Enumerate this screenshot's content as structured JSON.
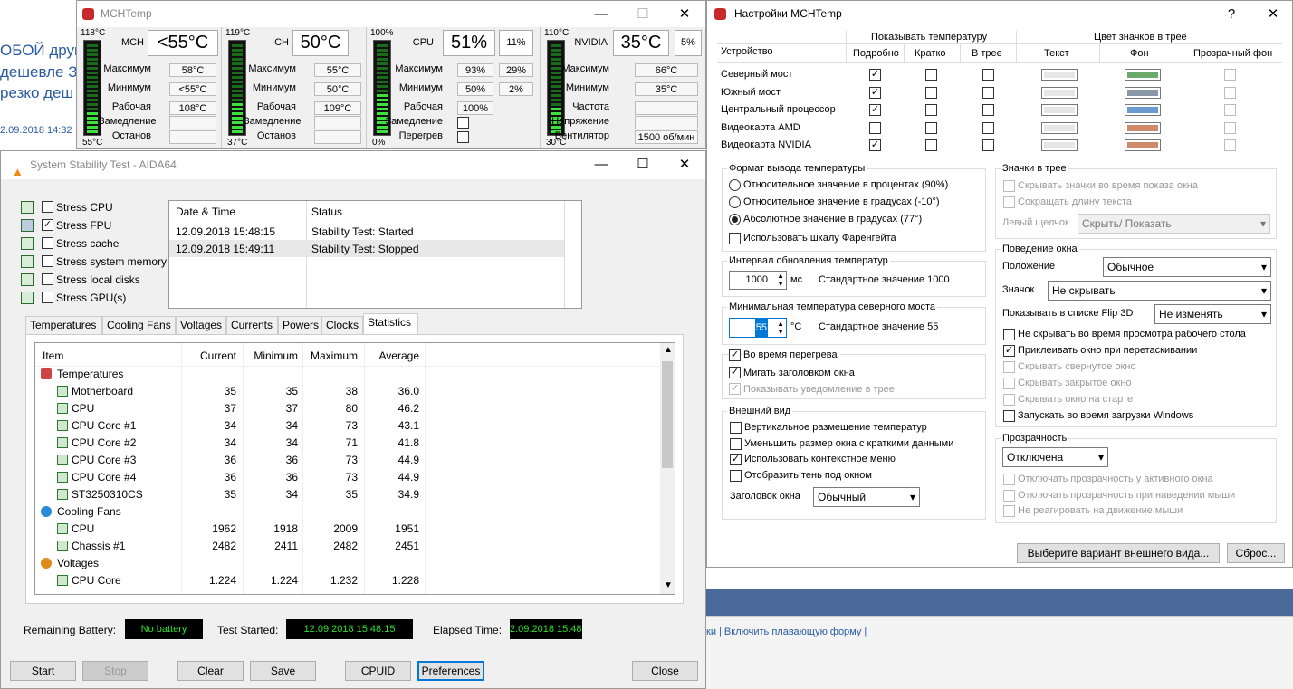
{
  "background": {
    "lines": [
      "ОБОЙ друг",
      "дешевле З",
      "резко деш"
    ],
    "date": "2.09.2018 14:32",
    "bottom_links": "ки | Включить плавающую форму |"
  },
  "mch": {
    "title": "MCHTemp",
    "sections": [
      {
        "top": "118°C",
        "bottom": "55°C",
        "name": "MCH",
        "value": "<55°C",
        "extra": "",
        "rows": [
          [
            "Максимум",
            "58°C"
          ],
          [
            "Минимум",
            "<55°C"
          ],
          [
            "Рабочая",
            "108°C"
          ],
          [
            "Замедление",
            ""
          ],
          [
            "Останов",
            ""
          ]
        ]
      },
      {
        "top": "119°C",
        "bottom": "37°C",
        "name": "ICH",
        "value": "50°C",
        "extra": "",
        "rows": [
          [
            "Максимум",
            "55°C"
          ],
          [
            "Минимум",
            "50°C"
          ],
          [
            "Рабочая",
            "109°C"
          ],
          [
            "Замедление",
            ""
          ],
          [
            "Останов",
            ""
          ]
        ]
      },
      {
        "top": "100%",
        "bottom": "0%",
        "name": "CPU",
        "value": "51%",
        "extra": "11%",
        "rows": [
          [
            "Максимум",
            "93%",
            "29%"
          ],
          [
            "Минимум",
            "50%",
            "2%"
          ],
          [
            "Рабочая",
            "100%"
          ],
          [
            "Замедление",
            ""
          ],
          [
            "Перегрев",
            ""
          ]
        ]
      },
      {
        "top": "110°C",
        "bottom": "30°C",
        "name": "NVIDIA",
        "value": "35°C",
        "extra": "5%",
        "rows": [
          [
            "Максимум",
            "66°C"
          ],
          [
            "Минимум",
            "35°C"
          ],
          [
            "Частота",
            ""
          ],
          [
            "Напряжение",
            ""
          ],
          [
            "Вентилятор",
            "1500 об/мин"
          ]
        ]
      }
    ]
  },
  "aida": {
    "title": "System Stability Test - AIDA64",
    "stress": [
      "Stress CPU",
      "Stress FPU",
      "Stress cache",
      "Stress system memory",
      "Stress local disks",
      "Stress GPU(s)"
    ],
    "stress_checked": [
      false,
      true,
      false,
      false,
      false,
      false
    ],
    "log_headers": [
      "Date & Time",
      "Status"
    ],
    "log": [
      [
        "12.09.2018 15:48:15",
        "Stability Test: Started"
      ],
      [
        "12.09.2018 15:49:11",
        "Stability Test: Stopped"
      ]
    ],
    "tabs": [
      "Temperatures",
      "Cooling Fans",
      "Voltages",
      "Currents",
      "Powers",
      "Clocks",
      "Statistics"
    ],
    "active_tab": "Statistics",
    "stat_headers": [
      "Item",
      "Current",
      "Minimum",
      "Maximum",
      "Average"
    ],
    "stats": [
      {
        "group": "Temperatures"
      },
      {
        "item": "Motherboard",
        "cur": "35",
        "min": "35",
        "max": "38",
        "avg": "36.0"
      },
      {
        "item": "CPU",
        "cur": "37",
        "min": "37",
        "max": "80",
        "avg": "46.2"
      },
      {
        "item": "CPU Core #1",
        "cur": "34",
        "min": "34",
        "max": "73",
        "avg": "43.1"
      },
      {
        "item": "CPU Core #2",
        "cur": "34",
        "min": "34",
        "max": "71",
        "avg": "41.8"
      },
      {
        "item": "CPU Core #3",
        "cur": "36",
        "min": "36",
        "max": "73",
        "avg": "44.9"
      },
      {
        "item": "CPU Core #4",
        "cur": "36",
        "min": "36",
        "max": "73",
        "avg": "44.9"
      },
      {
        "item": "ST3250310CS",
        "cur": "35",
        "min": "34",
        "max": "35",
        "avg": "34.9"
      },
      {
        "group": "Cooling Fans"
      },
      {
        "item": "CPU",
        "cur": "1962",
        "min": "1918",
        "max": "2009",
        "avg": "1951"
      },
      {
        "item": "Chassis #1",
        "cur": "2482",
        "min": "2411",
        "max": "2482",
        "avg": "2451"
      },
      {
        "group": "Voltages"
      },
      {
        "item": "CPU Core",
        "cur": "1.224",
        "min": "1.224",
        "max": "1.232",
        "avg": "1.228"
      }
    ],
    "battery_label": "Remaining Battery:",
    "battery_value": "No battery",
    "started_label": "Test Started:",
    "started_value": "12.09.2018 15:48:15",
    "elapsed_label": "Elapsed Time:",
    "elapsed_value": "2.09.2018 15:48:1",
    "buttons": {
      "start": "Start",
      "stop": "Stop",
      "clear": "Clear",
      "save": "Save",
      "cpuid": "CPUID",
      "prefs": "Preferences",
      "close": "Close"
    }
  },
  "settings": {
    "title": "Настройки MCHTemp",
    "help": "?",
    "hdr_show": "Показывать температуру",
    "hdr_color": "Цвет значков в трее",
    "col_device": "Устройство",
    "cols": [
      "Подробно",
      "Кратко",
      "В трее",
      "Текст",
      "Фон",
      "Прозрачный фон"
    ],
    "devices": [
      {
        "name": "Северный мост",
        "checks": [
          true,
          false,
          false
        ],
        "bg": "#6aaa6a"
      },
      {
        "name": "Южный мост",
        "checks": [
          true,
          false,
          false
        ],
        "bg": "#8a97a6"
      },
      {
        "name": "Центральный процессор",
        "checks": [
          true,
          false,
          false
        ],
        "bg": "#6a9ad0"
      },
      {
        "name": "Видеокарта AMD",
        "checks": [
          false,
          false,
          false
        ],
        "bg": "#cf8a6a"
      },
      {
        "name": "Видеокарта NVIDIA",
        "checks": [
          true,
          false,
          false
        ],
        "bg": "#cf8a6a"
      }
    ],
    "fmt_title": "Формат вывода температуры",
    "fmt_opts": [
      "Относительное значение в процентах (90%)",
      "Относительное значение в градусах (-10°)",
      "Абсолютное значение в градусах (77°)"
    ],
    "fahrenheit": "Использовать шкалу Фаренгейта",
    "interval_title": "Интервал обновления температур",
    "interval_value": "1000",
    "interval_unit": "мс",
    "interval_std": "Стандартное значение 1000",
    "min_title": "Минимальная температура северного моста",
    "min_value": "55",
    "min_unit": "°C",
    "min_std": "Стандартное значение 55",
    "overheat_title": "Во время перегрева",
    "blink": "Мигать заголовком окна",
    "notify": "Показывать уведомление в трее",
    "look_title": "Внешний вид",
    "look_opts": [
      "Вертикальное размещение температур",
      "Уменьшить размер окна с краткими данными",
      "Использовать контекстное меню",
      "Отобразить тень под окном"
    ],
    "look_checked": [
      false,
      false,
      true,
      false
    ],
    "caption_label": "Заголовок окна",
    "caption_value": "Обычный",
    "tray_title": "Значки в трее",
    "tray_opts": [
      "Скрывать значки во время показа окна",
      "Сокращать длину текста"
    ],
    "left_click_label": "Левый щелчок",
    "left_click_value": "Скрыть/ Показать",
    "behav_title": "Поведение окна",
    "pos_label": "Положение",
    "pos_value": "Обычное",
    "icon_label": "Значок",
    "icon_value": "Не скрывать",
    "flip_label": "Показывать в списке Flip 3D",
    "flip_value": "Не изменять",
    "behav_opts": [
      "Не скрывать во время просмотра рабочего стола",
      "Приклеивать окно при перетаскивании",
      "Скрывать свернутое окно",
      "Скрывать закрытое окно",
      "Скрывать окно на старте",
      "Запускать во время загрузки Windows"
    ],
    "behav_checked": [
      false,
      true,
      false,
      false,
      false,
      false
    ],
    "behav_disabled": [
      false,
      false,
      true,
      true,
      true,
      false
    ],
    "trans_title": "Прозрачность",
    "trans_value": "Отключена",
    "trans_opts": [
      "Отключать прозрачность у активного окна",
      "Отключать прозрачность при наведении мыши",
      "Не реагировать на движение мыши"
    ],
    "btn_theme": "Выберите вариант внешнего вида...",
    "btn_reset": "Сброс..."
  }
}
